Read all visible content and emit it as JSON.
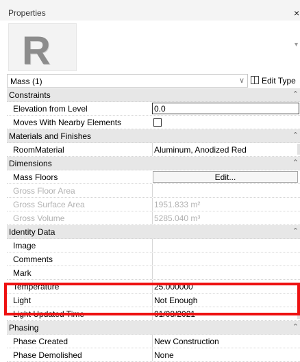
{
  "panel": {
    "title": "Properties",
    "close": "×"
  },
  "preview": {
    "logo": "R"
  },
  "type_selector": {
    "value": "Mass (1)",
    "edit_type": "Edit Type"
  },
  "groups": [
    {
      "name": "Constraints",
      "rows": [
        {
          "label": "Elevation from Level",
          "value": "0.0",
          "kind": "input"
        },
        {
          "label": "Moves With Nearby Elements",
          "value": "",
          "kind": "checkbox",
          "checked": false
        }
      ]
    },
    {
      "name": "Materials and Finishes",
      "rows": [
        {
          "label": "RoomMaterial",
          "value": "Aluminum, Anodized Red",
          "kind": "material"
        }
      ]
    },
    {
      "name": "Dimensions",
      "rows": [
        {
          "label": "Mass Floors",
          "value": "Edit...",
          "kind": "button"
        },
        {
          "label": "Gross Floor Area",
          "value": "",
          "kind": "readonly"
        },
        {
          "label": "Gross Surface Area",
          "value": "1951.833 m²",
          "kind": "readonly"
        },
        {
          "label": "Gross Volume",
          "value": "5285.040 m³",
          "kind": "readonly"
        }
      ]
    },
    {
      "name": "Identity Data",
      "rows": [
        {
          "label": "Image",
          "value": "",
          "kind": "text"
        },
        {
          "label": "Comments",
          "value": "",
          "kind": "text"
        },
        {
          "label": "Mark",
          "value": "",
          "kind": "text"
        },
        {
          "label": "Temperature",
          "value": "25.000000",
          "kind": "text"
        },
        {
          "label": "Light",
          "value": "Not Enough",
          "kind": "text"
        },
        {
          "label": "Light Updated Time",
          "value": "01/08/2021",
          "kind": "text"
        }
      ]
    },
    {
      "name": "Phasing",
      "rows": [
        {
          "label": "Phase Created",
          "value": "New Construction",
          "kind": "text"
        },
        {
          "label": "Phase Demolished",
          "value": "None",
          "kind": "text"
        }
      ]
    }
  ],
  "highlight_color": "#ee1111"
}
